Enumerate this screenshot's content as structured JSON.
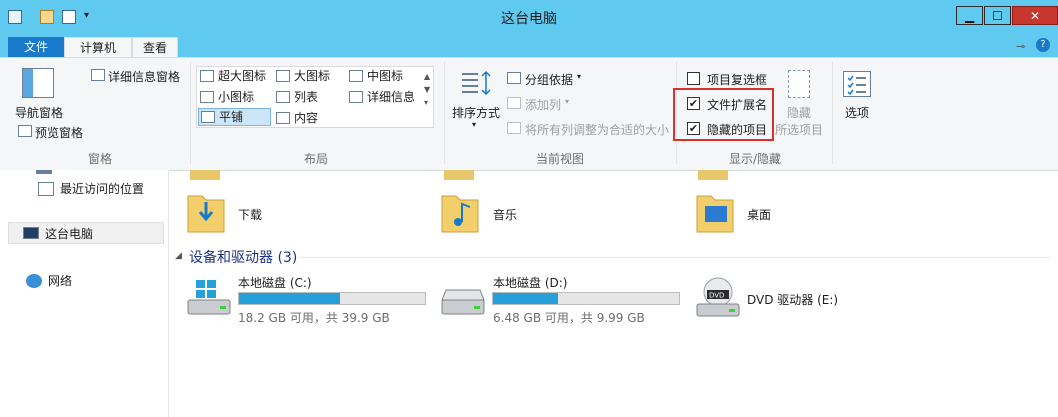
{
  "window": {
    "title": "这台电脑"
  },
  "window_buttons": {
    "minimize": "▁",
    "maximize": "☐",
    "close": "✕"
  },
  "tabs": [
    {
      "label": "文件"
    },
    {
      "label": "计算机"
    },
    {
      "label": "查看"
    }
  ],
  "ribbon": {
    "panes": {
      "group_label": "窗格",
      "nav_pane": "导航窗格",
      "preview_pane": "预览窗格",
      "details_pane": "详细信息窗格"
    },
    "layout": {
      "group_label": "布局",
      "items": [
        [
          "超大图标",
          "大图标",
          "中图标"
        ],
        [
          "小图标",
          "列表",
          "详细信息"
        ],
        [
          "平铺",
          "内容"
        ]
      ]
    },
    "current_view": {
      "group_label": "当前视图",
      "sort_by": "排序方式",
      "group_by": "分组依据",
      "add_column": "添加列",
      "fit_columns": "将所有列调整为合适的大小"
    },
    "show_hide": {
      "group_label": "显示/隐藏",
      "item_checkboxes": "项目复选框",
      "file_extensions": "文件扩展名",
      "hidden_items": "隐藏的项目",
      "hide_selected_line1": "隐藏",
      "hide_selected_line2": "所选项目",
      "item_checkboxes_checked": false,
      "file_extensions_checked": true,
      "hidden_items_checked": true
    },
    "options": {
      "label": "选项"
    }
  },
  "nav": {
    "recent_places": "最近访问的位置",
    "this_pc": "这台电脑",
    "network": "网络"
  },
  "folders": [
    {
      "name": "下载"
    },
    {
      "name": "音乐"
    },
    {
      "name": "桌面"
    }
  ],
  "devices": {
    "section_title": "设备和驱动器 (3)",
    "drives": [
      {
        "name": "本地磁盘 (C:)",
        "info": "18.2 GB 可用，共 39.9 GB",
        "used_fraction": 0.544
      },
      {
        "name": "本地磁盘 (D:)",
        "info": "6.48 GB 可用，共 9.99 GB",
        "used_fraction": 0.351
      },
      {
        "name": "DVD 驱动器 (E:)"
      }
    ]
  },
  "colors": {
    "accent": "#1979ca",
    "titlebar": "#5fc9ef",
    "highlight_box": "#d9302b",
    "bar": "#26a0da"
  }
}
